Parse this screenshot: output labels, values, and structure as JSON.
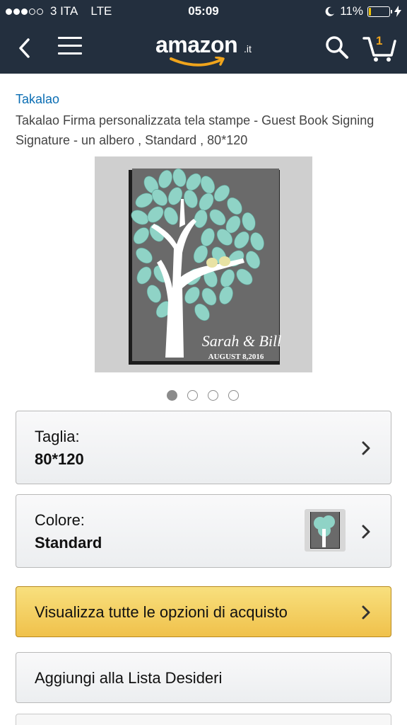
{
  "status_bar": {
    "carrier": "3 ITA",
    "network": "LTE",
    "time": "05:09",
    "battery": "11%",
    "battery_level": 0.11,
    "signal_bars_filled": 3,
    "signal_bars_total": 5,
    "icons": [
      "moon-icon",
      "battery-icon",
      "charging-bolt-icon"
    ]
  },
  "nav": {
    "logo_text": "amazon",
    "logo_tld": ".it",
    "cart_count": "1",
    "icons": [
      "back-chevron-icon",
      "hamburger-menu-icon",
      "search-icon",
      "cart-icon"
    ]
  },
  "product": {
    "brand": "Takalao",
    "title": "Takalao Firma personalizzata tela stampe - Guest Book Signing Signature - un albero , Standard , 80*120",
    "image_text": {
      "names": "Sarah & Bill",
      "date": "AUGUST 8,2016"
    },
    "image_count": 4,
    "active_image": 0
  },
  "options": {
    "size": {
      "label": "Taglia:",
      "value": "80*120"
    },
    "color": {
      "label": "Colore:",
      "value": "Standard"
    }
  },
  "actions": {
    "buy_label": "Visualizza tutte le opzioni di acquisto",
    "wishlist_label": "Aggiungi alla Lista Desideri"
  },
  "colors": {
    "header_bg": "#232f3e",
    "link": "#0a6db3",
    "buy_button": "#f0c14b",
    "amazon_orange": "#f0a41c",
    "leaf_mint": "#8fd3c6",
    "canvas_gray": "#6c6c6c"
  }
}
